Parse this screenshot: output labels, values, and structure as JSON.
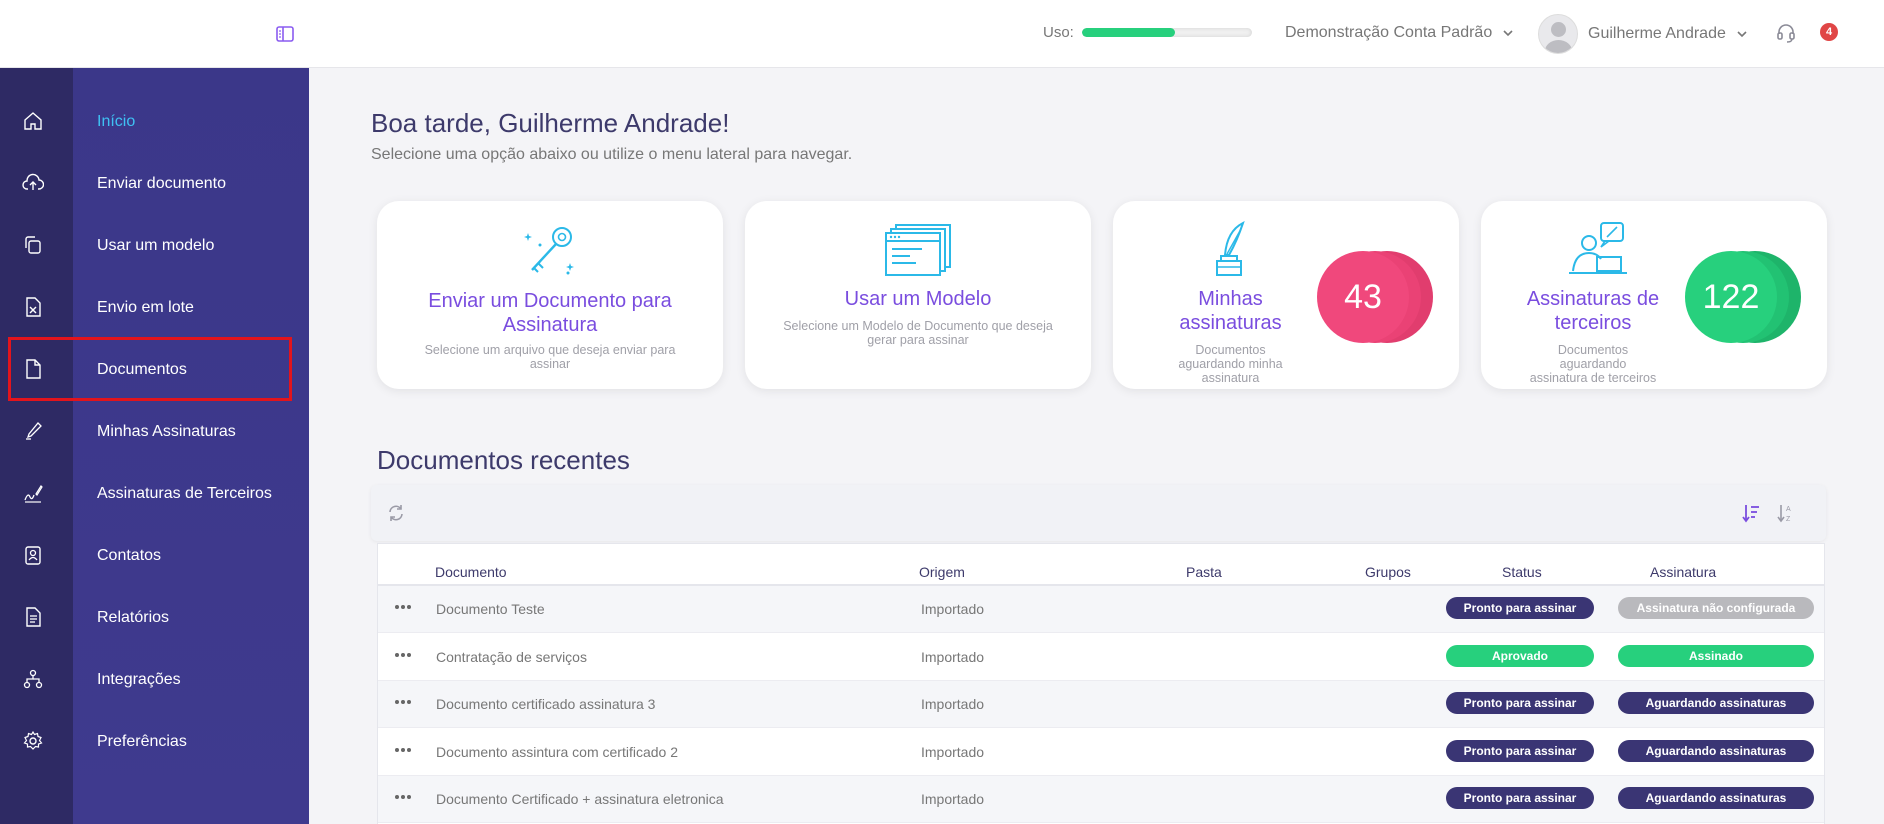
{
  "header": {
    "usage_label": "Uso:",
    "usage_fraction": 0.55,
    "account_name": "Demonstração Conta Padrão",
    "user_name": "Guilherme Andrade",
    "notification_count": "4"
  },
  "sidebar": {
    "items": [
      {
        "label": "Início",
        "icon": "home-icon"
      },
      {
        "label": "Enviar documento",
        "icon": "cloud-upload-icon"
      },
      {
        "label": "Usar um modelo",
        "icon": "copy-template-icon"
      },
      {
        "label": "Envio em lote",
        "icon": "spreadsheet-icon"
      },
      {
        "label": "Documentos",
        "icon": "document-icon"
      },
      {
        "label": "Minhas Assinaturas",
        "icon": "pen-icon"
      },
      {
        "label": "Assinaturas de Terceiros",
        "icon": "signature-icon"
      },
      {
        "label": "Contatos",
        "icon": "contact-icon"
      },
      {
        "label": "Relatórios",
        "icon": "report-icon"
      },
      {
        "label": "Integrações",
        "icon": "network-icon"
      },
      {
        "label": "Preferências",
        "icon": "gear-icon"
      }
    ]
  },
  "main": {
    "greeting": "Boa tarde, Guilherme Andrade!",
    "subtitle": "Selecione uma opção abaixo ou utilize o menu lateral para navegar.",
    "cards": [
      {
        "title_line1": "Enviar um Documento para",
        "title_line2": "Assinatura",
        "desc_line1": "Selecione um arquivo que deseja enviar para",
        "desc_line2": "assinar"
      },
      {
        "title": "Usar um Modelo",
        "desc_line1": "Selecione um Modelo de Documento que deseja",
        "desc_line2": "gerar para assinar"
      },
      {
        "title_line1": "Minhas",
        "title_line2": "assinaturas",
        "desc_line1": "Documentos",
        "desc_line2": "aguardando minha",
        "desc_line3": "assinatura",
        "count": "43",
        "color": "#f0487c"
      },
      {
        "title_line1": "Assinaturas de",
        "title_line2": "terceiros",
        "desc_line1": "Documentos",
        "desc_line2": "aguardando",
        "desc_line3": "assinatura de terceiros",
        "count": "122",
        "color": "#27d07d"
      }
    ],
    "recent_title": "Documentos recentes",
    "table": {
      "columns": [
        "Documento",
        "Origem",
        "Pasta",
        "Grupos",
        "Status",
        "Assinatura"
      ],
      "rows": [
        {
          "documento": "Documento Teste",
          "origem": "Importado",
          "status": "Pronto para assinar",
          "assinatura": "Assinatura não configurada"
        },
        {
          "documento": "Contratação de serviços",
          "origem": "Importado",
          "status": "Aprovado",
          "assinatura": "Assinado"
        },
        {
          "documento": "Documento certificado assinatura 3",
          "origem": "Importado",
          "status": "Pronto para assinar",
          "assinatura": "Aguardando assinaturas"
        },
        {
          "documento": "Documento assintura com certificado 2",
          "origem": "Importado",
          "status": "Pronto para assinar",
          "assinatura": "Aguardando assinaturas"
        },
        {
          "documento": "Documento Certificado + assinatura eletronica",
          "origem": "Importado",
          "status": "Pronto para assinar",
          "assinatura": "Aguardando assinaturas"
        }
      ]
    },
    "colors": {
      "badge_navy": "#3a3574",
      "badge_green": "#27d07d",
      "badge_gray": "#b9b9bd",
      "accent_purple": "#7a4ddf",
      "accent_cyan": "#3fc1f3"
    }
  }
}
